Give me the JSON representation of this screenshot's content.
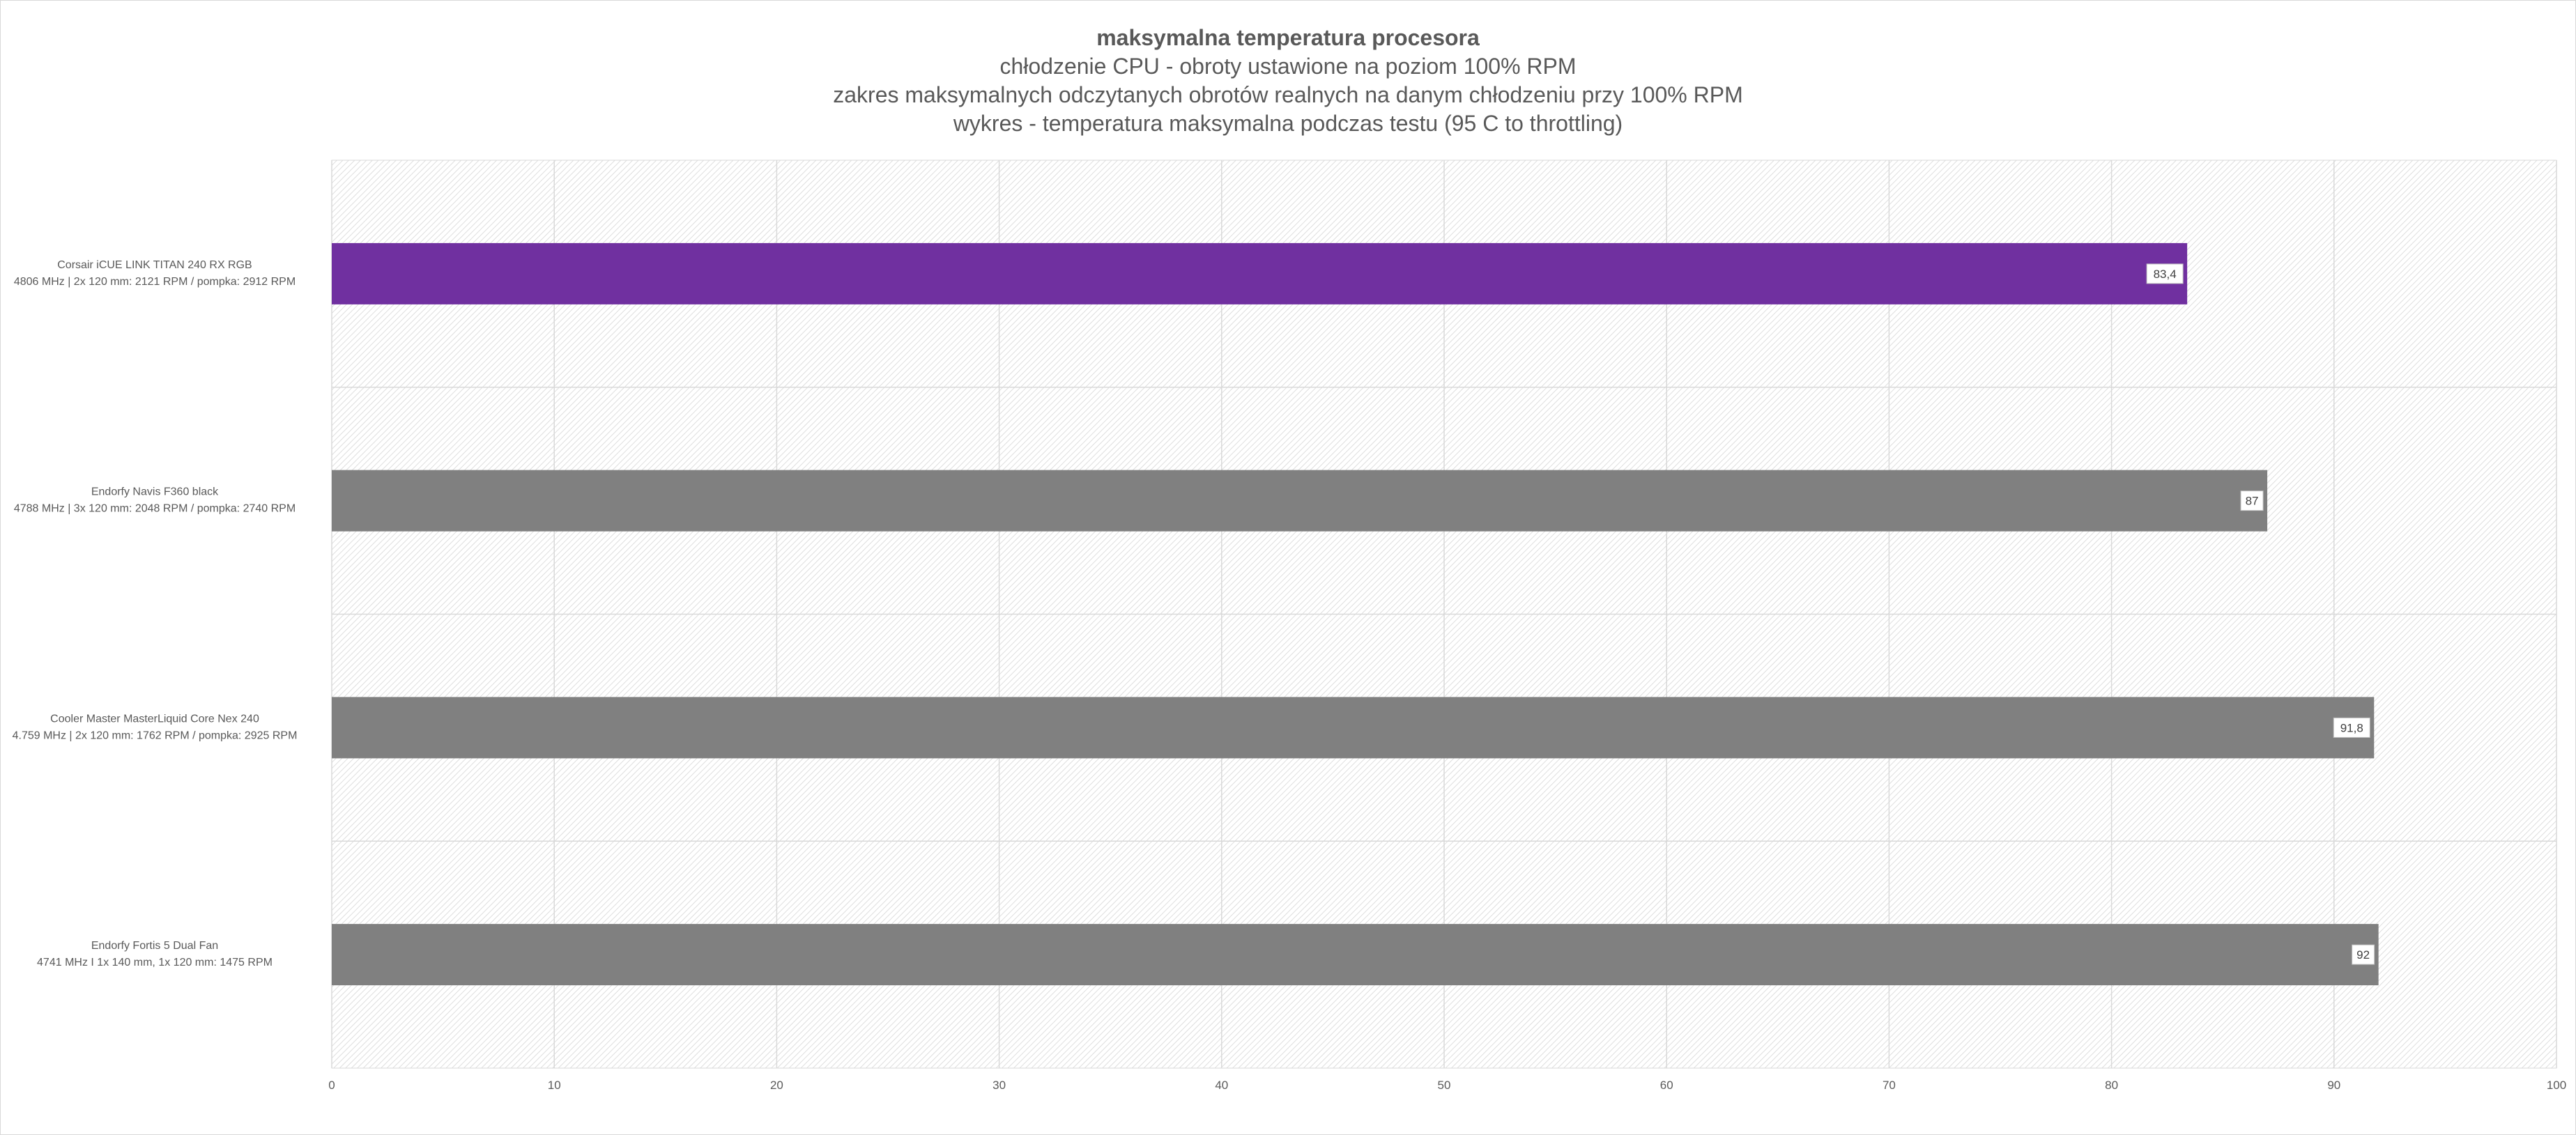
{
  "chart_data": {
    "type": "bar",
    "orientation": "horizontal",
    "title": "maksymalna temperatura procesora",
    "subtitles": [
      "chłodzenie CPU - obroty ustawione na poziom 100% RPM",
      "zakres maksymalnych odczytanych obrotów realnych na danym chłodzeniu przy 100% RPM",
      "wykres - temperatura maksymalna podczas testu (95 C to throttling)"
    ],
    "categories": [
      [
        "Corsair iCUE LINK TITAN 240 RX RGB",
        "4806 MHz | 2x 120 mm: 2121 RPM / pompka: 2912 RPM"
      ],
      [
        "Endorfy Navis F360 black",
        "4788 MHz | 3x 120 mm: 2048 RPM / pompka: 2740 RPM"
      ],
      [
        "Cooler Master MasterLiquid Core Nex 240",
        "4.759 MHz | 2x 120 mm: 1762 RPM / pompka: 2925 RPM"
      ],
      [
        "Endorfy Fortis 5 Dual Fan",
        "4741 MHz I 1x 140 mm, 1x 120 mm: 1475 RPM"
      ]
    ],
    "values": [
      83.4,
      87,
      91.8,
      92
    ],
    "value_labels": [
      "83,4",
      "87",
      "91,8",
      "92"
    ],
    "bar_colors": [
      "#7030a0",
      "#808080",
      "#808080",
      "#808080"
    ],
    "xlim": [
      0,
      100
    ],
    "xticks": [
      0,
      10,
      20,
      30,
      40,
      50,
      60,
      70,
      80,
      90,
      100
    ],
    "grid": true,
    "legend": "none"
  }
}
